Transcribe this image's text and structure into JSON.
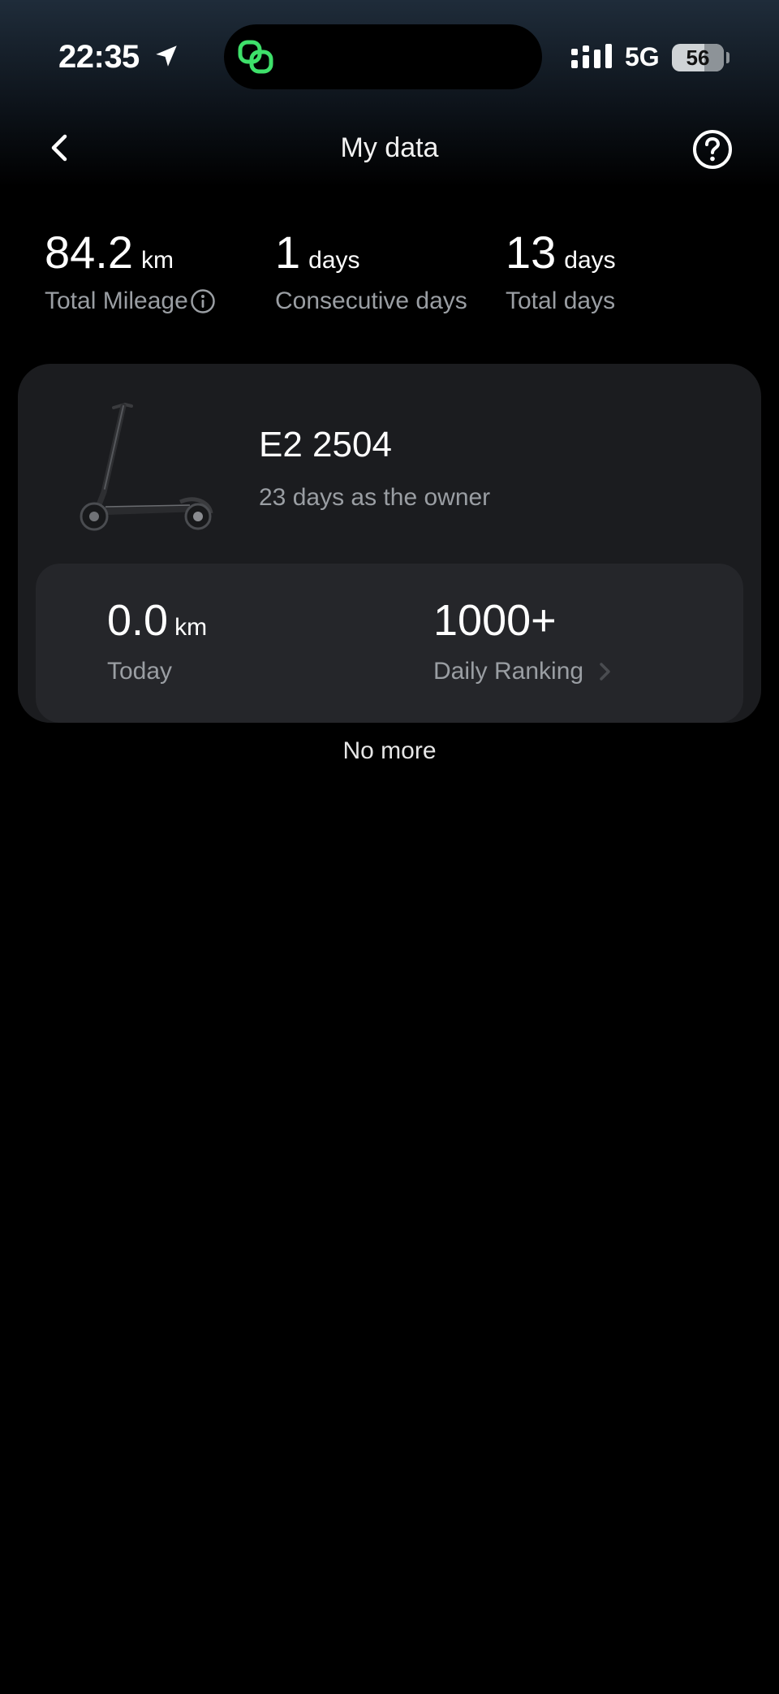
{
  "status_bar": {
    "time": "22:35",
    "network": "5G",
    "battery_level": "56",
    "icons": [
      "location-arrow-icon",
      "linked-rings-icon",
      "cellular-signal-icon",
      "battery-icon"
    ],
    "island_icon_color": "#3ee06a"
  },
  "nav": {
    "title": "My data",
    "back_icon": "chevron-left-icon",
    "help_icon": "question-circle-icon"
  },
  "summary": {
    "mileage": {
      "value": "84.2",
      "unit": "km",
      "label": "Total Mileage",
      "icon": "info-icon"
    },
    "consecutive": {
      "value": "1",
      "unit": "days",
      "label": "Consecutive days"
    },
    "total": {
      "value": "13",
      "unit": "days",
      "label": "Total days"
    }
  },
  "vehicle": {
    "name": "E2 2504",
    "owner_days": "23 days as the owner",
    "image_icon": "kick-scooter-image",
    "today": {
      "value": "0.0",
      "unit": "km",
      "label": "Today"
    },
    "ranking": {
      "value": "1000+",
      "label": "Daily Ranking",
      "icon": "chevron-right-icon"
    }
  },
  "footer": {
    "text": "No more"
  },
  "colors": {
    "background": "#000000",
    "card": "#1b1c1f",
    "inner_card": "#25262a",
    "secondary_text": "#9a9ea3"
  }
}
